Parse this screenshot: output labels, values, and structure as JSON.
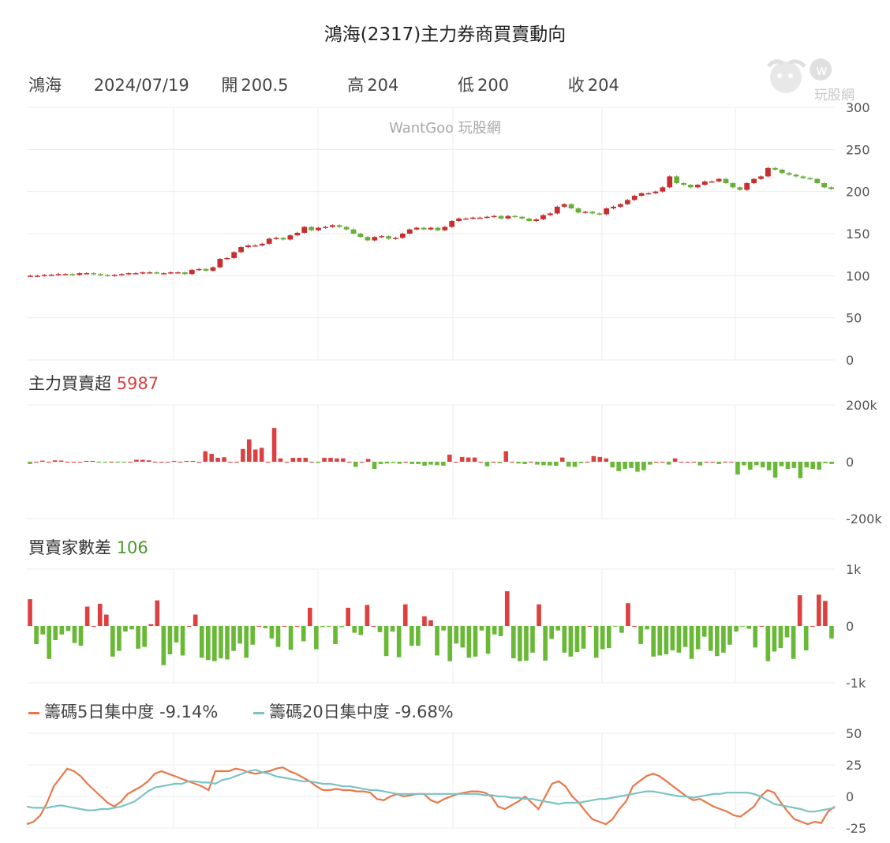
{
  "header": {
    "title": "鴻海(2317)主力券商買賣動向"
  },
  "info": {
    "name": "鴻海",
    "date": "2024/07/19",
    "open_label": "開",
    "open": "200.5",
    "high_label": "高",
    "high": "204",
    "low_label": "低",
    "low": "200",
    "close_label": "收",
    "close": "204"
  },
  "watermark": "WantGoo 玩股網",
  "logo_text": "玩股網",
  "sections": {
    "main_force_label": "主力買賣超",
    "main_force_value": "5987",
    "brokers_label": "買賣家數差",
    "brokers_value": "106",
    "conc5_label": "籌碼5日集中度",
    "conc5_value": "-9.14%",
    "conc20_label": "籌碼20日集中度",
    "conc20_value": "-9.68%"
  },
  "colors": {
    "up": "#c62f2f",
    "down": "#6aae3a",
    "bar_pos": "#dc4040",
    "bar_neg": "#69b937",
    "conc5": "#e8784a",
    "conc20": "#7bc3c3",
    "grid": "#ececec"
  },
  "chart_data": [
    {
      "type": "candlestick",
      "ylim": [
        0,
        300
      ],
      "yticks": [
        "0",
        "50",
        "100",
        "150",
        "200",
        "250",
        "300"
      ],
      "close": [
        100,
        100,
        101,
        101,
        102,
        102,
        101,
        103,
        103,
        102,
        101,
        100,
        101,
        102,
        103,
        103,
        104,
        104,
        103,
        103,
        104,
        104,
        102,
        107,
        108,
        106,
        110,
        120,
        121,
        128,
        134,
        136,
        136,
        138,
        144,
        145,
        143,
        148,
        151,
        158,
        154,
        157,
        158,
        160,
        158,
        155,
        150,
        146,
        142,
        146,
        147,
        144,
        145,
        150,
        155,
        157,
        155,
        157,
        154,
        158,
        165,
        168,
        168,
        169,
        169,
        170,
        171,
        168,
        171,
        170,
        168,
        165,
        167,
        172,
        174,
        182,
        185,
        180,
        175,
        176,
        174,
        173,
        180,
        182,
        185,
        190,
        195,
        198,
        198,
        200,
        205,
        218,
        210,
        208,
        205,
        208,
        212,
        212,
        215,
        210,
        205,
        202,
        210,
        215,
        218,
        228,
        226,
        222,
        220,
        218,
        216,
        215,
        210,
        205,
        203
      ],
      "note": "approximate closes"
    },
    {
      "type": "bar",
      "name": "主力買賣超",
      "ylim": [
        -200000,
        200000
      ],
      "yticks": [
        "-200k",
        "0",
        "200k"
      ],
      "values": [
        -8000,
        0,
        4000,
        0,
        5000,
        4000,
        0,
        0,
        0,
        3000,
        3000,
        -2000,
        -2000,
        0,
        -3000,
        -3000,
        0,
        7000,
        7000,
        5000,
        0,
        0,
        0,
        3000,
        0,
        3000,
        3000,
        0,
        37000,
        28000,
        14000,
        16000,
        0,
        0,
        45000,
        79000,
        43000,
        49000,
        0,
        119000,
        12000,
        0,
        14000,
        14000,
        14000,
        0,
        -4000,
        14000,
        14000,
        12000,
        12000,
        0,
        -18000,
        0,
        10000,
        -25000,
        -8000,
        -6000,
        -4000,
        -7000,
        0,
        -8000,
        -8000,
        -14000,
        -10000,
        -12000,
        -14000,
        25000,
        0,
        17000,
        15000,
        15000,
        0,
        -16000,
        0,
        -5000,
        37000,
        0,
        -6000,
        -8000,
        0,
        -10000,
        -12000,
        -13000,
        -14000,
        15000,
        -17000,
        -18000,
        -5000,
        0,
        20000,
        17000,
        12000,
        -20000,
        -33000,
        -25000,
        -22000,
        -35000,
        -30000,
        -10000,
        0,
        0,
        -10000,
        12000,
        0,
        0,
        0,
        -13000,
        0,
        0,
        -8000,
        0,
        0,
        -45000,
        -12000,
        -28000,
        -12000,
        -20000,
        -30000,
        -56000,
        -16000,
        -25000,
        -22000,
        -58000,
        -20000,
        -25000,
        -28000,
        -5000,
        -8000
      ],
      "note": "approximate"
    },
    {
      "type": "bar",
      "name": "買賣家數差",
      "ylim": [
        -1000,
        1000
      ],
      "yticks": [
        "-1k",
        "0",
        "1k"
      ],
      "values": [
        470,
        -320,
        -150,
        -580,
        -250,
        -150,
        -90,
        -300,
        -350,
        340,
        0,
        390,
        200,
        -540,
        -440,
        -100,
        -60,
        -400,
        -370,
        30,
        450,
        -690,
        -500,
        -290,
        -520,
        0,
        200,
        -560,
        -600,
        -620,
        -570,
        -590,
        -440,
        -310,
        -560,
        -330,
        0,
        -40,
        -220,
        -370,
        0,
        -420,
        0,
        -270,
        320,
        -410,
        -20,
        -10,
        -320,
        -20,
        320,
        -120,
        -160,
        370,
        0,
        -110,
        -530,
        -100,
        -550,
        380,
        -350,
        -350,
        170,
        100,
        -520,
        -80,
        -620,
        -310,
        -380,
        -560,
        -540,
        -80,
        -490,
        -150,
        -180,
        610,
        -570,
        -620,
        -610,
        -470,
        380,
        -610,
        -230,
        -80,
        -470,
        -540,
        -460,
        -400,
        0,
        -560,
        -410,
        -390,
        -10,
        -120,
        400,
        0,
        -320,
        -60,
        -540,
        -520,
        -500,
        -430,
        -470,
        -370,
        -580,
        -410,
        -190,
        -440,
        -530,
        -470,
        -330,
        -100,
        -10,
        -50,
        -380,
        0,
        -620,
        -450,
        -390,
        -200,
        -580,
        540,
        -430,
        0,
        550,
        440,
        -220
      ],
      "note": "approximate"
    },
    {
      "type": "line",
      "name": "籌碼5日集中度 / 籌碼20日集中度",
      "ylim": [
        -25,
        50
      ],
      "yticks": [
        "-25",
        "0",
        "25",
        "50"
      ],
      "series": [
        {
          "name": "籌碼5日集中度",
          "values": [
            -22,
            -20,
            -15,
            -5,
            8,
            15,
            22,
            20,
            16,
            10,
            5,
            0,
            -5,
            -8,
            -4,
            2,
            5,
            8,
            12,
            18,
            20,
            18,
            16,
            14,
            12,
            10,
            8,
            5,
            20,
            20,
            20,
            22,
            21,
            19,
            18,
            19,
            20,
            22,
            23,
            20,
            18,
            15,
            12,
            8,
            5,
            5,
            6,
            5,
            5,
            4,
            4,
            3,
            -2,
            -3,
            0,
            2,
            0,
            1,
            2,
            2,
            -3,
            -5,
            -2,
            0,
            2,
            3,
            4,
            4,
            3,
            0,
            -8,
            -10,
            -7,
            -4,
            0,
            -5,
            -10,
            0,
            10,
            12,
            8,
            0,
            -5,
            -12,
            -18,
            -20,
            -22,
            -18,
            -10,
            -4,
            8,
            12,
            16,
            18,
            16,
            12,
            8,
            4,
            0,
            -3,
            -2,
            -5,
            -8,
            -10,
            -12,
            -15,
            -16,
            -12,
            -8,
            0,
            5,
            3,
            -5,
            -12,
            -18,
            -20,
            -22,
            -20,
            -21,
            -12,
            -8
          ]
        },
        {
          "name": "籌碼20日集中度",
          "values": [
            -8,
            -9,
            -9,
            -9,
            -8,
            -7,
            -8,
            -9,
            -10,
            -11,
            -11,
            -10,
            -10,
            -9,
            -8,
            -6,
            -4,
            0,
            4,
            7,
            8,
            9,
            10,
            10,
            12,
            12,
            11,
            11,
            10,
            13,
            14,
            16,
            18,
            20,
            21,
            19,
            18,
            16,
            15,
            14,
            13,
            12,
            12,
            11,
            10,
            10,
            9,
            8,
            8,
            7,
            6,
            5,
            5,
            4,
            3,
            2,
            2,
            2,
            2,
            2,
            2,
            2,
            2,
            2,
            2,
            2,
            2,
            2,
            1,
            1,
            0,
            0,
            -1,
            -1,
            -2,
            -2,
            -3,
            -4,
            -5,
            -6,
            -5,
            -5,
            -5,
            -4,
            -3,
            -2,
            -2,
            -1,
            0,
            1,
            2,
            3,
            4,
            4,
            3,
            2,
            1,
            0,
            0,
            -1,
            0,
            1,
            2,
            2,
            3,
            3,
            3,
            3,
            2,
            0,
            -3,
            -6,
            -7,
            -8,
            -9,
            -10,
            -12,
            -12,
            -11,
            -10,
            -9
          ]
        }
      ]
    }
  ]
}
